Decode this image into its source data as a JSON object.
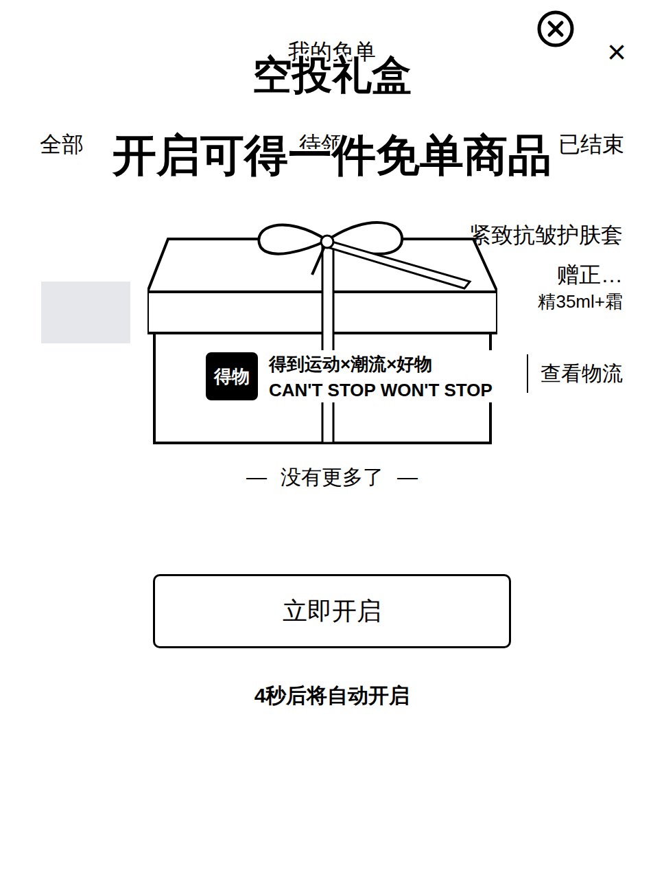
{
  "page": {
    "title": "我的免单",
    "close": "×",
    "tabs": [
      {
        "label": "全部"
      },
      {
        "label": "待领"
      },
      {
        "label": "已结束"
      }
    ],
    "item": {
      "title_lines": [
        "紧致抗皱护肤套",
        "赠正…",
        "精35ml+霜"
      ],
      "action": "查看物流"
    },
    "footer": {
      "left": "—",
      "text": "没有更多了",
      "right": "—"
    }
  },
  "popup": {
    "title": "空投礼盒",
    "subtitle": "开启可得一件免单商品",
    "box": {
      "logo": "得物",
      "slogan": "得到运动×潮流×好物",
      "tagline": "CAN'T STOP WON'T STOP"
    },
    "button": "立即开启",
    "countdown": "4秒后将自动开启"
  }
}
